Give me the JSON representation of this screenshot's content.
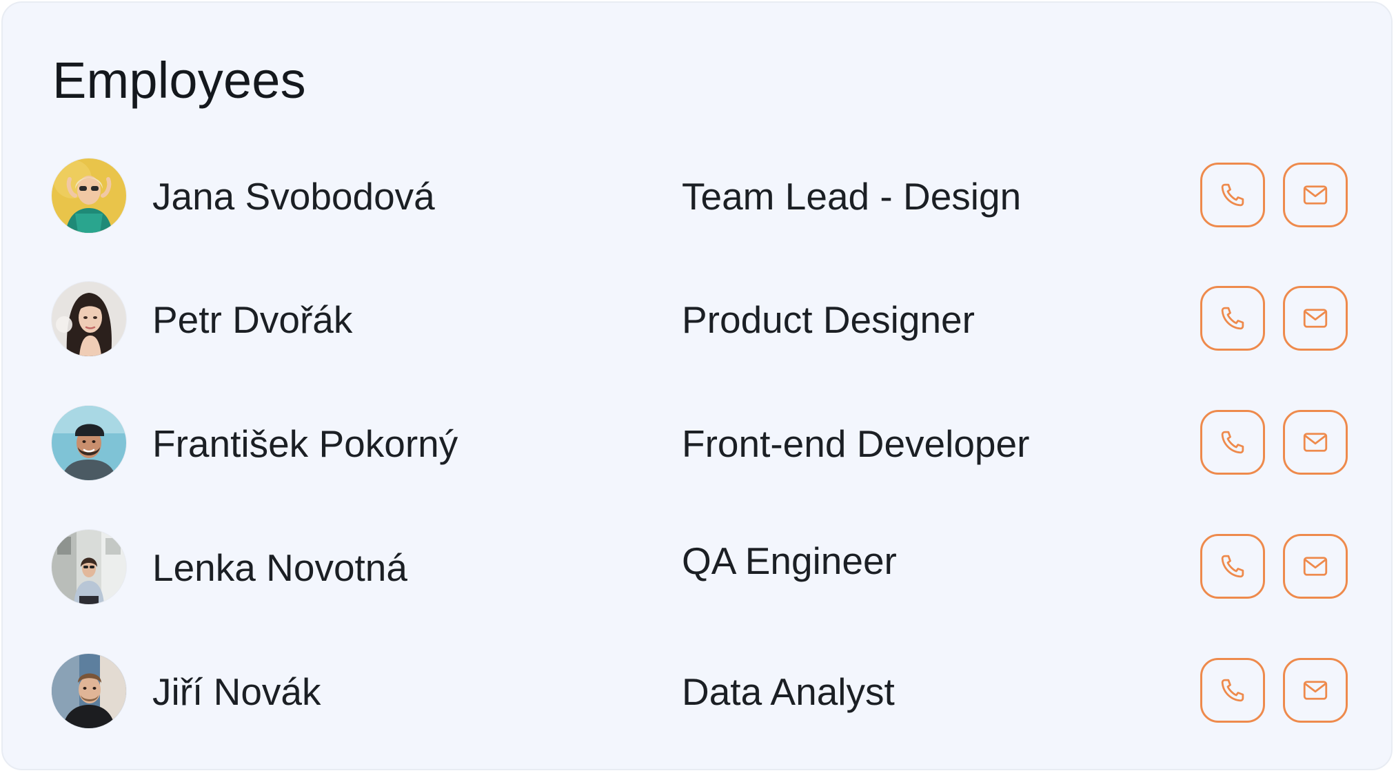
{
  "card": {
    "title": "Employees"
  },
  "colors": {
    "accent": "#ee8a4c",
    "card_background": "#f3f6fd",
    "text": "#1b1f24"
  },
  "employees": [
    {
      "name": "Jana Svobodová",
      "role": "Team Lead - Design",
      "avatar_icon": "avatar-photo",
      "call_icon": "phone-icon",
      "email_icon": "mail-icon"
    },
    {
      "name": "Petr Dvořák",
      "role": "Product Designer",
      "avatar_icon": "avatar-photo",
      "call_icon": "phone-icon",
      "email_icon": "mail-icon"
    },
    {
      "name": "František Pokorný",
      "role": "Front-end Developer",
      "avatar_icon": "avatar-photo",
      "call_icon": "phone-icon",
      "email_icon": "mail-icon"
    },
    {
      "name": "Lenka Novotná",
      "role": "QA Engineer",
      "avatar_icon": "avatar-photo",
      "call_icon": "phone-icon",
      "email_icon": "mail-icon"
    },
    {
      "name": "Jiří Novák",
      "role": "Data Analyst",
      "avatar_icon": "avatar-photo",
      "call_icon": "phone-icon",
      "email_icon": "mail-icon"
    }
  ]
}
